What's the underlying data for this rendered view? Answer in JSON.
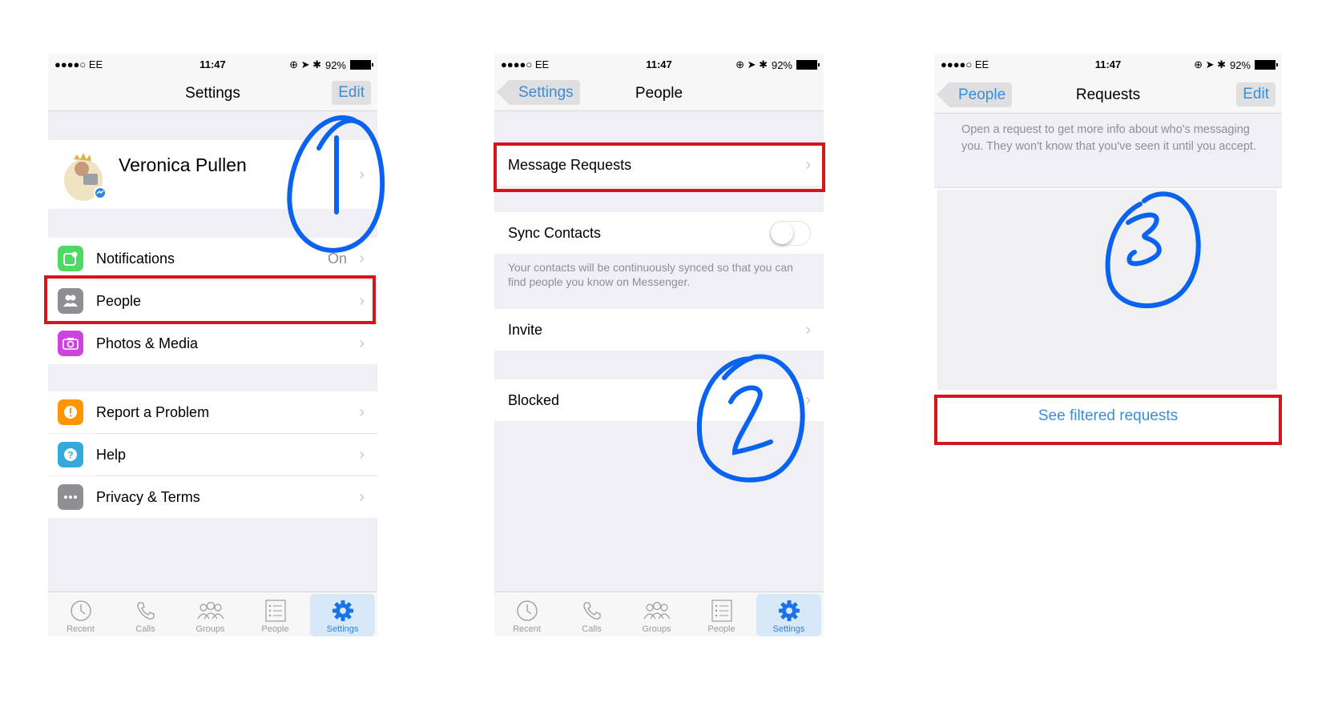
{
  "status_bar": {
    "carrier": "●●●●○ EE",
    "time": "11:47",
    "battery": "92%"
  },
  "panel1": {
    "nav": {
      "title": "Settings",
      "edit_label": "Edit"
    },
    "profile": {
      "name": "Veronica Pullen"
    },
    "rows": [
      {
        "label": "Notifications",
        "value": "On",
        "icon": "notification-icon",
        "color": "#4cd964"
      },
      {
        "label": "People",
        "icon": "people-icon",
        "color": "#8e8e93"
      },
      {
        "label": "Photos & Media",
        "icon": "camera-icon",
        "color": "#cc44dd"
      },
      {
        "label": "Report a Problem",
        "icon": "alert-icon",
        "color": "#ff9500"
      },
      {
        "label": "Help",
        "icon": "help-icon",
        "color": "#34aadc"
      },
      {
        "label": "Privacy & Terms",
        "icon": "more-icon",
        "color": "#8e8e93"
      }
    ],
    "annotation": "1"
  },
  "panel2": {
    "nav": {
      "back_label": "Settings",
      "title": "People"
    },
    "rows": {
      "message_requests": "Message Requests",
      "sync_contacts": "Sync Contacts",
      "sync_footer": "Your contacts will be continuously synced so that you can find people you know on Messenger.",
      "invite": "Invite",
      "blocked": "Blocked"
    },
    "sync_contacts_on": false,
    "annotation": "2"
  },
  "panel3": {
    "nav": {
      "back_label": "People",
      "title": "Requests",
      "edit_label": "Edit"
    },
    "info_text": "Open a request to get more info about who's messaging you. They won't know that you've seen it until you accept.",
    "filtered_link": "See filtered requests",
    "annotation": "3"
  },
  "tabbar": {
    "tabs": [
      {
        "label": "Recent",
        "icon": "clock-icon"
      },
      {
        "label": "Calls",
        "icon": "phone-icon"
      },
      {
        "label": "Groups",
        "icon": "groups-icon"
      },
      {
        "label": "People",
        "icon": "list-icon"
      },
      {
        "label": "Settings",
        "icon": "gear-icon",
        "active": true
      }
    ]
  },
  "colors": {
    "accent": "#3a8ed6",
    "highlight_box": "#d6141c",
    "annotation_ink": "#0a62f0"
  }
}
